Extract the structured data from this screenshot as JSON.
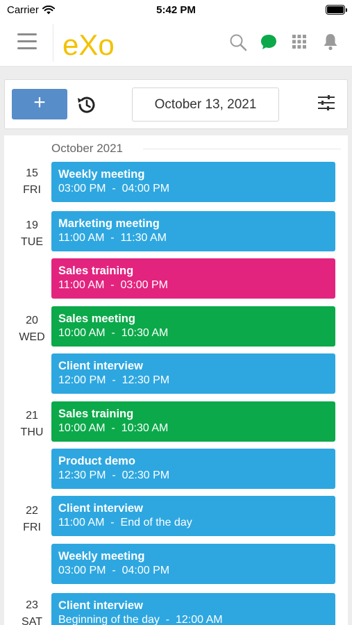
{
  "status_bar": {
    "carrier": "Carrier",
    "time": "5:42 PM"
  },
  "header": {
    "logo_text": "eXo"
  },
  "toolbar": {
    "add_label": "+",
    "date_label": "October 13, 2021"
  },
  "list": {
    "month": "October 2021",
    "days": [
      {
        "num": "15",
        "name": "FRI"
      },
      {
        "num": "19",
        "name": "TUE"
      },
      {
        "num": "20",
        "name": "WED"
      },
      {
        "num": "21",
        "name": "THU"
      },
      {
        "num": "22",
        "name": "FRI"
      },
      {
        "num": "23",
        "name": "SAT"
      }
    ],
    "events": [
      {
        "title": "Weekly meeting",
        "time": "03:00 PM  -  04:00 PM",
        "color": "#2ea7e0"
      },
      {
        "title": "Marketing meeting",
        "time": "11:00 AM  -  11:30 AM",
        "color": "#2ea7e0"
      },
      {
        "title": "Sales training",
        "time": "11:00 AM  -  03:00 PM",
        "color": "#e3247f"
      },
      {
        "title": "Sales meeting",
        "time": "10:00 AM  -  10:30 AM",
        "color": "#0ca94a"
      },
      {
        "title": "Client interview",
        "time": "12:00 PM  -  12:30 PM",
        "color": "#2ea7e0"
      },
      {
        "title": "Sales training",
        "time": "10:00 AM  -  10:30 AM",
        "color": "#0ca94a"
      },
      {
        "title": "Product demo",
        "time": "12:30 PM  -  02:30 PM",
        "color": "#2ea7e0"
      },
      {
        "title": "Client interview",
        "time": "11:00 AM  -  End of the day",
        "color": "#2ea7e0"
      },
      {
        "title": "Weekly meeting",
        "time": "03:00 PM  -  04:00 PM",
        "color": "#2ea7e0"
      },
      {
        "title": "Client interview",
        "time": "Beginning of the day  -  12:00 AM",
        "color": "#2ea7e0"
      }
    ]
  },
  "colors": {
    "accent": "#578dc9",
    "chat": "#0ca94a",
    "logo_yellow": "#f2c200"
  },
  "icons": [
    "menu-icon",
    "search-icon",
    "chat-icon",
    "apps-grid-icon",
    "bell-icon",
    "history-icon",
    "filter-icon",
    "wifi-icon",
    "battery-icon"
  ]
}
